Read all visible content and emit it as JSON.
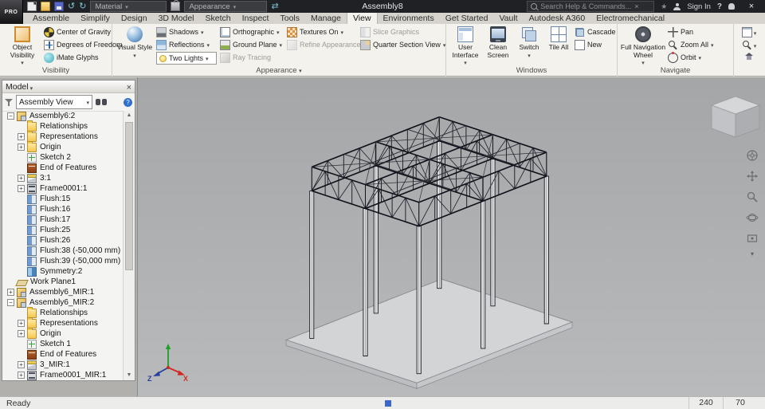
{
  "titlebar": {
    "logo": "PRO",
    "material_label": "Material",
    "appearance_label": "Appearance",
    "title": "Assembly8",
    "search_placeholder": "Search Help & Commands...",
    "sign_in": "Sign In"
  },
  "tabs": {
    "active": "View",
    "items": [
      "Assemble",
      "Simplify",
      "Design",
      "3D Model",
      "Sketch",
      "Inspect",
      "Tools",
      "Manage",
      "View",
      "Environments",
      "Get Started",
      "Vault",
      "Autodesk A360",
      "Electromechanical"
    ]
  },
  "ribbon": {
    "visibility": {
      "label": "Visibility",
      "object_visibility": "Object Visibility",
      "center_of_gravity": "Center of Gravity",
      "degrees_of_freedom": "Degrees of Freedom",
      "imate_glyphs": "iMate Glyphs"
    },
    "appearance": {
      "label": "Appearance",
      "visual_style": "Visual Style",
      "shadows": "Shadows",
      "reflections": "Reflections",
      "two_lights": "Two Lights",
      "orthographic": "Orthographic",
      "ground_plane": "Ground Plane",
      "ray_tracing": "Ray Tracing",
      "textures_on": "Textures On",
      "refine_appearance": "Refine Appearance",
      "slice_graphics": "Slice Graphics",
      "quarter_section_view": "Quarter Section View"
    },
    "windows": {
      "label": "Windows",
      "user_interface": "User Interface",
      "clean_screen": "Clean Screen",
      "switch": "Switch",
      "tile_all": "Tile All",
      "cascade": "Cascade",
      "new": "New"
    },
    "navigate": {
      "label": "Navigate",
      "full_navigation_wheel": "Full Navigation Wheel",
      "pan": "Pan",
      "zoom_all": "Zoom All",
      "orbit": "Orbit"
    }
  },
  "browser": {
    "title": "Model",
    "view_selector": "Assembly View",
    "tree": [
      {
        "lvl": 0,
        "exp": "−",
        "icon": "assembly",
        "label": "Assembly6:2"
      },
      {
        "lvl": 1,
        "exp": "",
        "icon": "folder",
        "label": "Relationships"
      },
      {
        "lvl": 1,
        "exp": "+",
        "icon": "folder",
        "label": "Representations"
      },
      {
        "lvl": 1,
        "exp": "+",
        "icon": "folder",
        "label": "Origin"
      },
      {
        "lvl": 1,
        "exp": "",
        "icon": "sketch",
        "label": "Sketch 2"
      },
      {
        "lvl": 1,
        "exp": "",
        "icon": "eof",
        "label": "End of Features"
      },
      {
        "lvl": 1,
        "exp": "+",
        "icon": "part",
        "label": "3:1"
      },
      {
        "lvl": 1,
        "exp": "+",
        "icon": "frame",
        "label": "Frame0001:1"
      },
      {
        "lvl": 1,
        "exp": "",
        "icon": "flush",
        "label": "Flush:15"
      },
      {
        "lvl": 1,
        "exp": "",
        "icon": "flush",
        "label": "Flush:16"
      },
      {
        "lvl": 1,
        "exp": "",
        "icon": "flush",
        "label": "Flush:17"
      },
      {
        "lvl": 1,
        "exp": "",
        "icon": "flush",
        "label": "Flush:25"
      },
      {
        "lvl": 1,
        "exp": "",
        "icon": "flush",
        "label": "Flush:26"
      },
      {
        "lvl": 1,
        "exp": "",
        "icon": "flush",
        "label": "Flush:38 (-50,000 mm)"
      },
      {
        "lvl": 1,
        "exp": "",
        "icon": "flush",
        "label": "Flush:39 (-50,000 mm)"
      },
      {
        "lvl": 1,
        "exp": "",
        "icon": "symmetry",
        "label": "Symmetry:2"
      },
      {
        "lvl": 0,
        "exp": "",
        "icon": "workplane",
        "label": "Work Plane1"
      },
      {
        "lvl": 0,
        "exp": "+",
        "icon": "assembly",
        "label": "Assembly6_MIR:1"
      },
      {
        "lvl": 0,
        "exp": "−",
        "icon": "assembly",
        "label": "Assembly6_MIR:2"
      },
      {
        "lvl": 1,
        "exp": "",
        "icon": "folder",
        "label": "Relationships"
      },
      {
        "lvl": 1,
        "exp": "+",
        "icon": "folder",
        "label": "Representations"
      },
      {
        "lvl": 1,
        "exp": "+",
        "icon": "folder",
        "label": "Origin"
      },
      {
        "lvl": 1,
        "exp": "",
        "icon": "sketch",
        "label": "Sketch 1"
      },
      {
        "lvl": 1,
        "exp": "",
        "icon": "eof",
        "label": "End of Features"
      },
      {
        "lvl": 1,
        "exp": "+",
        "icon": "part",
        "label": "3_MIR:1"
      },
      {
        "lvl": 1,
        "exp": "+",
        "icon": "frame",
        "label": "Frame0001_MIR:1"
      }
    ]
  },
  "viewport": {
    "axis_x": "X",
    "axis_z": "Z"
  },
  "statusbar": {
    "ready": "Ready",
    "value1": "240",
    "value2": "70"
  }
}
